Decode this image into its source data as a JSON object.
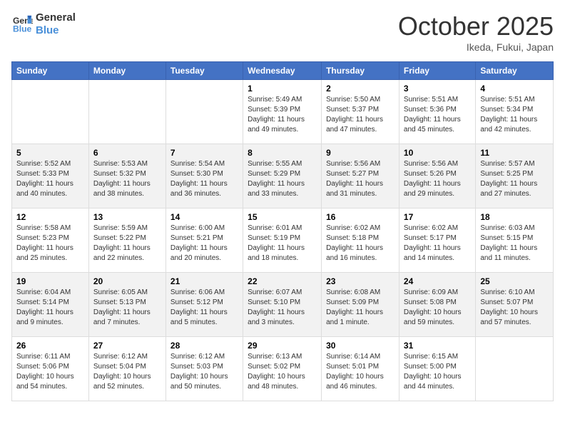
{
  "header": {
    "logo_line1": "General",
    "logo_line2": "Blue",
    "month": "October 2025",
    "location": "Ikeda, Fukui, Japan"
  },
  "days_of_week": [
    "Sunday",
    "Monday",
    "Tuesday",
    "Wednesday",
    "Thursday",
    "Friday",
    "Saturday"
  ],
  "weeks": [
    [
      {
        "num": "",
        "info": ""
      },
      {
        "num": "",
        "info": ""
      },
      {
        "num": "",
        "info": ""
      },
      {
        "num": "1",
        "info": "Sunrise: 5:49 AM\nSunset: 5:39 PM\nDaylight: 11 hours and 49 minutes."
      },
      {
        "num": "2",
        "info": "Sunrise: 5:50 AM\nSunset: 5:37 PM\nDaylight: 11 hours and 47 minutes."
      },
      {
        "num": "3",
        "info": "Sunrise: 5:51 AM\nSunset: 5:36 PM\nDaylight: 11 hours and 45 minutes."
      },
      {
        "num": "4",
        "info": "Sunrise: 5:51 AM\nSunset: 5:34 PM\nDaylight: 11 hours and 42 minutes."
      }
    ],
    [
      {
        "num": "5",
        "info": "Sunrise: 5:52 AM\nSunset: 5:33 PM\nDaylight: 11 hours and 40 minutes."
      },
      {
        "num": "6",
        "info": "Sunrise: 5:53 AM\nSunset: 5:32 PM\nDaylight: 11 hours and 38 minutes."
      },
      {
        "num": "7",
        "info": "Sunrise: 5:54 AM\nSunset: 5:30 PM\nDaylight: 11 hours and 36 minutes."
      },
      {
        "num": "8",
        "info": "Sunrise: 5:55 AM\nSunset: 5:29 PM\nDaylight: 11 hours and 33 minutes."
      },
      {
        "num": "9",
        "info": "Sunrise: 5:56 AM\nSunset: 5:27 PM\nDaylight: 11 hours and 31 minutes."
      },
      {
        "num": "10",
        "info": "Sunrise: 5:56 AM\nSunset: 5:26 PM\nDaylight: 11 hours and 29 minutes."
      },
      {
        "num": "11",
        "info": "Sunrise: 5:57 AM\nSunset: 5:25 PM\nDaylight: 11 hours and 27 minutes."
      }
    ],
    [
      {
        "num": "12",
        "info": "Sunrise: 5:58 AM\nSunset: 5:23 PM\nDaylight: 11 hours and 25 minutes."
      },
      {
        "num": "13",
        "info": "Sunrise: 5:59 AM\nSunset: 5:22 PM\nDaylight: 11 hours and 22 minutes."
      },
      {
        "num": "14",
        "info": "Sunrise: 6:00 AM\nSunset: 5:21 PM\nDaylight: 11 hours and 20 minutes."
      },
      {
        "num": "15",
        "info": "Sunrise: 6:01 AM\nSunset: 5:19 PM\nDaylight: 11 hours and 18 minutes."
      },
      {
        "num": "16",
        "info": "Sunrise: 6:02 AM\nSunset: 5:18 PM\nDaylight: 11 hours and 16 minutes."
      },
      {
        "num": "17",
        "info": "Sunrise: 6:02 AM\nSunset: 5:17 PM\nDaylight: 11 hours and 14 minutes."
      },
      {
        "num": "18",
        "info": "Sunrise: 6:03 AM\nSunset: 5:15 PM\nDaylight: 11 hours and 11 minutes."
      }
    ],
    [
      {
        "num": "19",
        "info": "Sunrise: 6:04 AM\nSunset: 5:14 PM\nDaylight: 11 hours and 9 minutes."
      },
      {
        "num": "20",
        "info": "Sunrise: 6:05 AM\nSunset: 5:13 PM\nDaylight: 11 hours and 7 minutes."
      },
      {
        "num": "21",
        "info": "Sunrise: 6:06 AM\nSunset: 5:12 PM\nDaylight: 11 hours and 5 minutes."
      },
      {
        "num": "22",
        "info": "Sunrise: 6:07 AM\nSunset: 5:10 PM\nDaylight: 11 hours and 3 minutes."
      },
      {
        "num": "23",
        "info": "Sunrise: 6:08 AM\nSunset: 5:09 PM\nDaylight: 11 hours and 1 minute."
      },
      {
        "num": "24",
        "info": "Sunrise: 6:09 AM\nSunset: 5:08 PM\nDaylight: 10 hours and 59 minutes."
      },
      {
        "num": "25",
        "info": "Sunrise: 6:10 AM\nSunset: 5:07 PM\nDaylight: 10 hours and 57 minutes."
      }
    ],
    [
      {
        "num": "26",
        "info": "Sunrise: 6:11 AM\nSunset: 5:06 PM\nDaylight: 10 hours and 54 minutes."
      },
      {
        "num": "27",
        "info": "Sunrise: 6:12 AM\nSunset: 5:04 PM\nDaylight: 10 hours and 52 minutes."
      },
      {
        "num": "28",
        "info": "Sunrise: 6:12 AM\nSunset: 5:03 PM\nDaylight: 10 hours and 50 minutes."
      },
      {
        "num": "29",
        "info": "Sunrise: 6:13 AM\nSunset: 5:02 PM\nDaylight: 10 hours and 48 minutes."
      },
      {
        "num": "30",
        "info": "Sunrise: 6:14 AM\nSunset: 5:01 PM\nDaylight: 10 hours and 46 minutes."
      },
      {
        "num": "31",
        "info": "Sunrise: 6:15 AM\nSunset: 5:00 PM\nDaylight: 10 hours and 44 minutes."
      },
      {
        "num": "",
        "info": ""
      }
    ]
  ]
}
